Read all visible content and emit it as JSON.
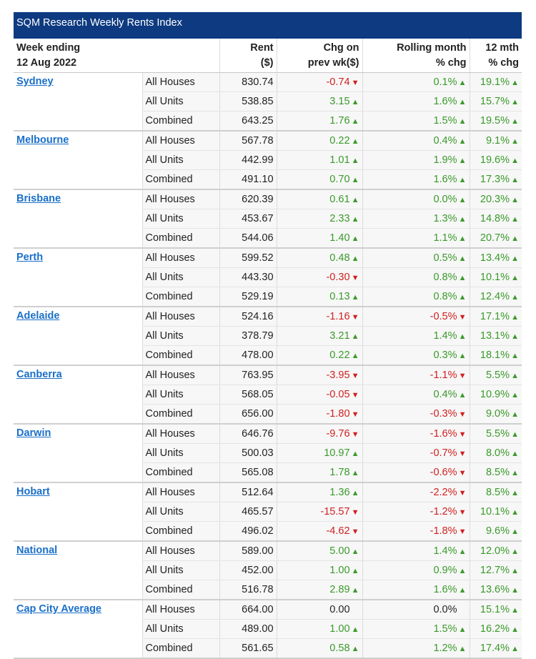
{
  "title": "SQM Research Weekly Rents Index",
  "header": {
    "col1_line1": "Week ending",
    "col1_line2": "12 Aug 2022",
    "rent_line1": "Rent",
    "rent_line2": "($)",
    "chg_line1": "Chg on",
    "chg_line2": "prev wk($)",
    "roll_line1": "Rolling month",
    "roll_line2": "% chg",
    "yr_line1": "12 mth",
    "yr_line2": "% chg"
  },
  "colors": {
    "title_bg": "#0d3a80",
    "up": "#3a9a2a",
    "down": "#d11f1f",
    "link": "#1a6fc9"
  },
  "icons": {
    "up": "triangle-up-icon",
    "down": "triangle-down-icon"
  },
  "cities": [
    {
      "name": "Sydney",
      "rows": [
        {
          "type": "All Houses",
          "rent": "830.74",
          "chg": "-0.74",
          "chg_dir": "down",
          "roll": "0.1%",
          "roll_dir": "up",
          "yr": "19.1%",
          "yr_dir": "up"
        },
        {
          "type": "All Units",
          "rent": "538.85",
          "chg": "3.15",
          "chg_dir": "up",
          "roll": "1.6%",
          "roll_dir": "up",
          "yr": "15.7%",
          "yr_dir": "up"
        },
        {
          "type": "Combined",
          "rent": "643.25",
          "chg": "1.76",
          "chg_dir": "up",
          "roll": "1.5%",
          "roll_dir": "up",
          "yr": "19.5%",
          "yr_dir": "up"
        }
      ]
    },
    {
      "name": "Melbourne",
      "rows": [
        {
          "type": "All Houses",
          "rent": "567.78",
          "chg": "0.22",
          "chg_dir": "up",
          "roll": "0.4%",
          "roll_dir": "up",
          "yr": "9.1%",
          "yr_dir": "up"
        },
        {
          "type": "All Units",
          "rent": "442.99",
          "chg": "1.01",
          "chg_dir": "up",
          "roll": "1.9%",
          "roll_dir": "up",
          "yr": "19.6%",
          "yr_dir": "up"
        },
        {
          "type": "Combined",
          "rent": "491.10",
          "chg": "0.70",
          "chg_dir": "up",
          "roll": "1.6%",
          "roll_dir": "up",
          "yr": "17.3%",
          "yr_dir": "up"
        }
      ]
    },
    {
      "name": "Brisbane",
      "rows": [
        {
          "type": "All Houses",
          "rent": "620.39",
          "chg": "0.61",
          "chg_dir": "up",
          "roll": "0.0%",
          "roll_dir": "up",
          "yr": "20.3%",
          "yr_dir": "up"
        },
        {
          "type": "All Units",
          "rent": "453.67",
          "chg": "2.33",
          "chg_dir": "up",
          "roll": "1.3%",
          "roll_dir": "up",
          "yr": "14.8%",
          "yr_dir": "up"
        },
        {
          "type": "Combined",
          "rent": "544.06",
          "chg": "1.40",
          "chg_dir": "up",
          "roll": "1.1%",
          "roll_dir": "up",
          "yr": "20.7%",
          "yr_dir": "up"
        }
      ]
    },
    {
      "name": "Perth",
      "rows": [
        {
          "type": "All Houses",
          "rent": "599.52",
          "chg": "0.48",
          "chg_dir": "up",
          "roll": "0.5%",
          "roll_dir": "up",
          "yr": "13.4%",
          "yr_dir": "up"
        },
        {
          "type": "All Units",
          "rent": "443.30",
          "chg": "-0.30",
          "chg_dir": "down",
          "roll": "0.8%",
          "roll_dir": "up",
          "yr": "10.1%",
          "yr_dir": "up"
        },
        {
          "type": "Combined",
          "rent": "529.19",
          "chg": "0.13",
          "chg_dir": "up",
          "roll": "0.8%",
          "roll_dir": "up",
          "yr": "12.4%",
          "yr_dir": "up"
        }
      ]
    },
    {
      "name": "Adelaide",
      "rows": [
        {
          "type": "All Houses",
          "rent": "524.16",
          "chg": "-1.16",
          "chg_dir": "down",
          "roll": "-0.5%",
          "roll_dir": "down",
          "yr": "17.1%",
          "yr_dir": "up"
        },
        {
          "type": "All Units",
          "rent": "378.79",
          "chg": "3.21",
          "chg_dir": "up",
          "roll": "1.4%",
          "roll_dir": "up",
          "yr": "13.1%",
          "yr_dir": "up"
        },
        {
          "type": "Combined",
          "rent": "478.00",
          "chg": "0.22",
          "chg_dir": "up",
          "roll": "0.3%",
          "roll_dir": "up",
          "yr": "18.1%",
          "yr_dir": "up"
        }
      ]
    },
    {
      "name": "Canberra",
      "rows": [
        {
          "type": "All Houses",
          "rent": "763.95",
          "chg": "-3.95",
          "chg_dir": "down",
          "roll": "-1.1%",
          "roll_dir": "down",
          "yr": "5.5%",
          "yr_dir": "up"
        },
        {
          "type": "All Units",
          "rent": "568.05",
          "chg": "-0.05",
          "chg_dir": "down",
          "roll": "0.4%",
          "roll_dir": "up",
          "yr": "10.9%",
          "yr_dir": "up"
        },
        {
          "type": "Combined",
          "rent": "656.00",
          "chg": "-1.80",
          "chg_dir": "down",
          "roll": "-0.3%",
          "roll_dir": "down",
          "yr": "9.0%",
          "yr_dir": "up"
        }
      ]
    },
    {
      "name": "Darwin",
      "rows": [
        {
          "type": "All Houses",
          "rent": "646.76",
          "chg": "-9.76",
          "chg_dir": "down",
          "roll": "-1.6%",
          "roll_dir": "down",
          "yr": "5.5%",
          "yr_dir": "up"
        },
        {
          "type": "All Units",
          "rent": "500.03",
          "chg": "10.97",
          "chg_dir": "up",
          "roll": "-0.7%",
          "roll_dir": "down",
          "yr": "8.0%",
          "yr_dir": "up"
        },
        {
          "type": "Combined",
          "rent": "565.08",
          "chg": "1.78",
          "chg_dir": "up",
          "roll": "-0.6%",
          "roll_dir": "down",
          "yr": "8.5%",
          "yr_dir": "up"
        }
      ]
    },
    {
      "name": "Hobart",
      "rows": [
        {
          "type": "All Houses",
          "rent": "512.64",
          "chg": "1.36",
          "chg_dir": "up",
          "roll": "-2.2%",
          "roll_dir": "down",
          "yr": "8.5%",
          "yr_dir": "up"
        },
        {
          "type": "All Units",
          "rent": "465.57",
          "chg": "-15.57",
          "chg_dir": "down",
          "roll": "-1.2%",
          "roll_dir": "down",
          "yr": "10.1%",
          "yr_dir": "up"
        },
        {
          "type": "Combined",
          "rent": "496.02",
          "chg": "-4.62",
          "chg_dir": "down",
          "roll": "-1.8%",
          "roll_dir": "down",
          "yr": "9.6%",
          "yr_dir": "up"
        }
      ]
    },
    {
      "name": "National",
      "rows": [
        {
          "type": "All Houses",
          "rent": "589.00",
          "chg": "5.00",
          "chg_dir": "up",
          "roll": "1.4%",
          "roll_dir": "up",
          "yr": "12.0%",
          "yr_dir": "up"
        },
        {
          "type": "All Units",
          "rent": "452.00",
          "chg": "1.00",
          "chg_dir": "up",
          "roll": "0.9%",
          "roll_dir": "up",
          "yr": "12.7%",
          "yr_dir": "up"
        },
        {
          "type": "Combined",
          "rent": "516.78",
          "chg": "2.89",
          "chg_dir": "up",
          "roll": "1.6%",
          "roll_dir": "up",
          "yr": "13.6%",
          "yr_dir": "up"
        }
      ]
    },
    {
      "name": "Cap City Average",
      "rows": [
        {
          "type": "All Houses",
          "rent": "664.00",
          "chg": "0.00",
          "chg_dir": "none",
          "roll": "0.0%",
          "roll_dir": "none",
          "yr": "15.1%",
          "yr_dir": "up"
        },
        {
          "type": "All Units",
          "rent": "489.00",
          "chg": "1.00",
          "chg_dir": "up",
          "roll": "1.5%",
          "roll_dir": "up",
          "yr": "16.2%",
          "yr_dir": "up"
        },
        {
          "type": "Combined",
          "rent": "561.65",
          "chg": "0.58",
          "chg_dir": "up",
          "roll": "1.2%",
          "roll_dir": "up",
          "yr": "17.4%",
          "yr_dir": "up"
        }
      ]
    }
  ]
}
